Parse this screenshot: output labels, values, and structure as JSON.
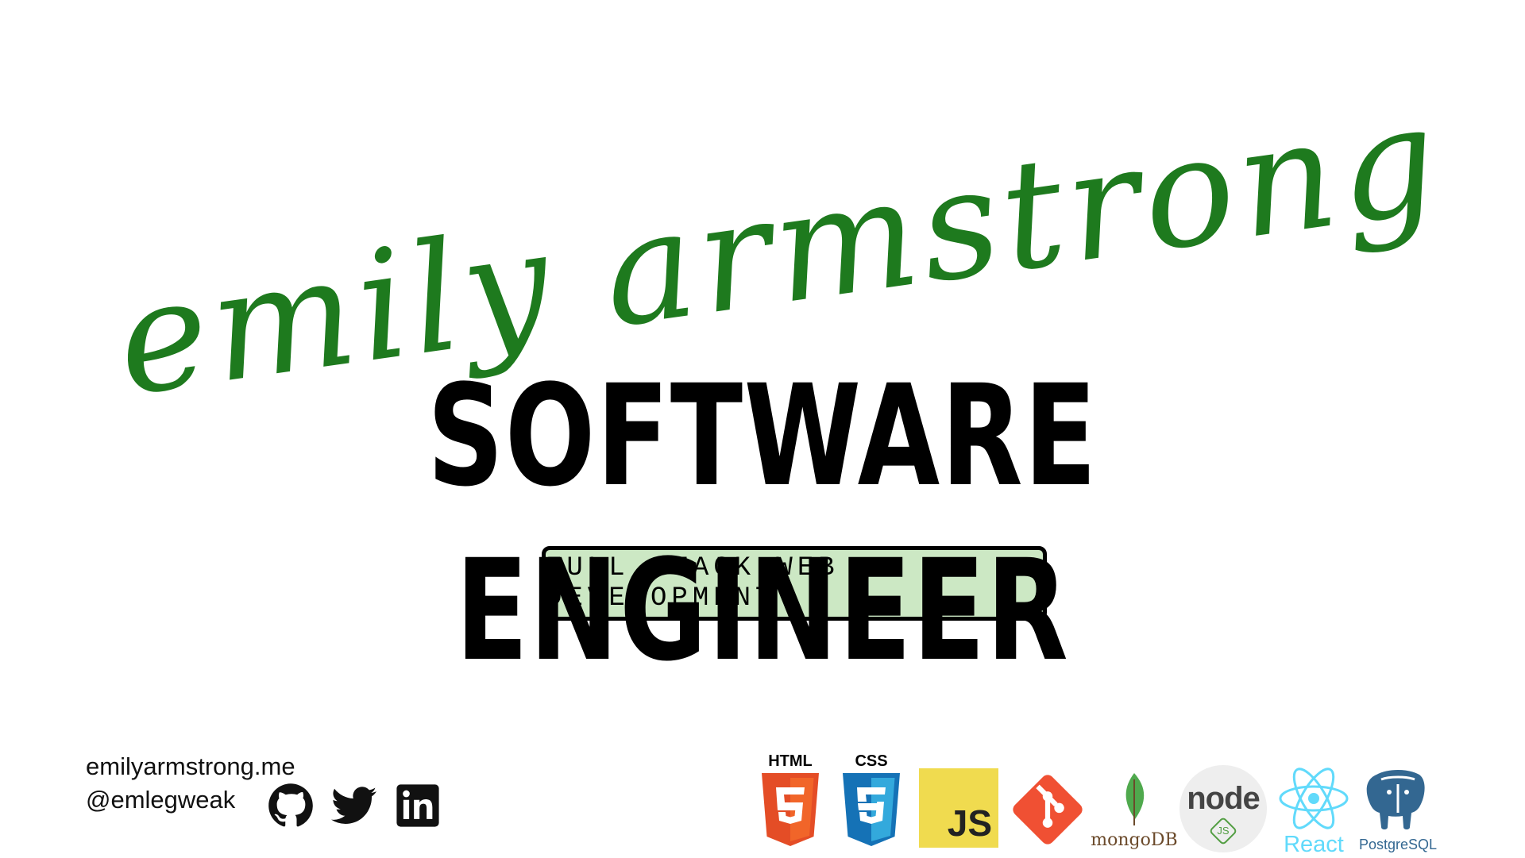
{
  "hero": {
    "name": "emily armstrong",
    "name_color": "#1e7a1e",
    "title": "SOFTWARE ENGINEER",
    "subtitle": "FULL STACK WEB DEVELOPMENT",
    "subtitle_bg": "#cce8c4"
  },
  "contact": {
    "website": "emilyarmstrong.me",
    "handle": "@emlegweak"
  },
  "socials": [
    {
      "name": "github-icon"
    },
    {
      "name": "twitter-icon"
    },
    {
      "name": "linkedin-icon"
    }
  ],
  "tech": {
    "html_label": "HTML",
    "css_label": "CSS",
    "js_label": "JS",
    "mongo_label": "mongoDB",
    "node_label": "node",
    "node_sub": "JS",
    "react_label": "React",
    "postgres_label": "PostgreSQL",
    "html_color": "#e44d26",
    "css_color": "#1572b6",
    "js_color": "#f0db4f",
    "git_color": "#f05033",
    "mongo_color": "#4fa94d",
    "node_color": "#539e43",
    "react_color": "#61dafb",
    "postgres_color": "#336791"
  }
}
